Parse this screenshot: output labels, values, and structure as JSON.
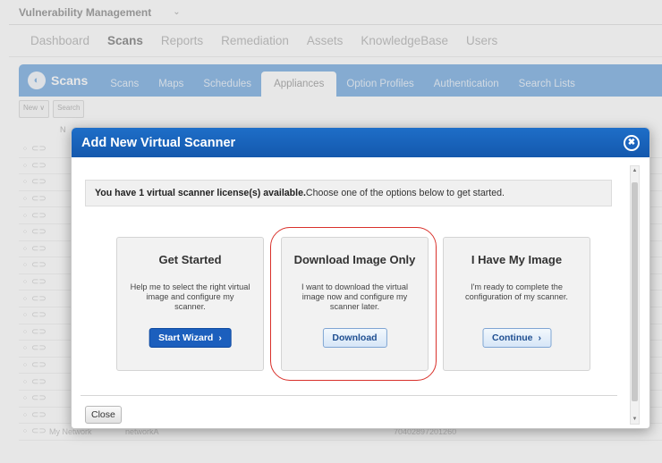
{
  "app": {
    "title": "Vulnerability Management",
    "title_caret": "⌄"
  },
  "main_nav": [
    {
      "label": "Dashboard",
      "active": false
    },
    {
      "label": "Scans",
      "active": true
    },
    {
      "label": "Reports",
      "active": false
    },
    {
      "label": "Remediation",
      "active": false
    },
    {
      "label": "Assets",
      "active": false
    },
    {
      "label": "KnowledgeBase",
      "active": false
    },
    {
      "label": "Users",
      "active": false
    }
  ],
  "tabs": {
    "brand_label": "Scans",
    "items": [
      {
        "label": "Scans",
        "active": false
      },
      {
        "label": "Maps",
        "active": false
      },
      {
        "label": "Schedules",
        "active": false
      },
      {
        "label": "Appliances",
        "active": true
      },
      {
        "label": "Option Profiles",
        "active": false
      },
      {
        "label": "Authentication",
        "active": false
      },
      {
        "label": "Search Lists",
        "active": false
      }
    ]
  },
  "toolbar": {
    "new_label": "New ∨",
    "search_label": "Search"
  },
  "table": {
    "col_head": "N",
    "last_row": {
      "name": "My Network",
      "network": "networkA",
      "id": "70402897201260"
    }
  },
  "modal": {
    "title": "Add New Virtual Scanner",
    "close_icon_glyph": "✖",
    "notice_bold": "You have 1 virtual scanner license(s) available.",
    "notice_rest": " Choose one of the options below to get started.",
    "cards": {
      "get_started": {
        "title": "Get Started",
        "description": "Help me to select the right virtual image and configure my scanner.",
        "button": "Start Wizard",
        "button_chevron": "›"
      },
      "download": {
        "title": "Download Image Only",
        "description": "I want to download the virtual image now and configure my scanner later.",
        "button": "Download"
      },
      "have_image": {
        "title": "I Have My Image",
        "description": "I'm ready to complete the configuration of my scanner.",
        "button": "Continue",
        "button_chevron": "›"
      }
    },
    "close_button": "Close"
  },
  "colors": {
    "modal_header": "#1560b8",
    "tab_bar": "#88b6e4",
    "highlight_ring": "#d9312b",
    "primary_button": "#1c5fbd"
  }
}
